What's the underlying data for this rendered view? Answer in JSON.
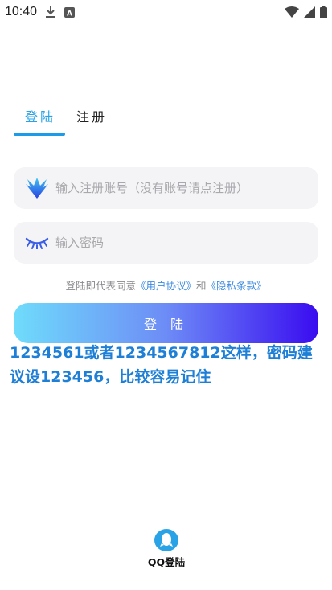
{
  "status_bar": {
    "time": "10:40",
    "icons": [
      "download-icon",
      "a-badge-icon",
      "wifi-icon",
      "signal-icon",
      "battery-icon"
    ]
  },
  "tabs": [
    {
      "label": "登陆",
      "active": true
    },
    {
      "label": "注册",
      "active": false
    }
  ],
  "account_field": {
    "placeholder": "输入注册账号（没有账号请点注册）",
    "value": "",
    "icon": "logo-icon"
  },
  "password_field": {
    "placeholder": "输入密码",
    "value": "",
    "icon": "closed-eye-icon"
  },
  "agreement": {
    "prefix": "登陆即代表同意",
    "user_agreement": "《用户协议》",
    "conjunction": "和",
    "privacy_policy": "《隐私条款》"
  },
  "login_button": {
    "label": "登 陆"
  },
  "hint_text": "1234561或者1234567812这样，密码建议设123456，比较容易记住",
  "qq_login": {
    "label": "QQ登陆",
    "icon": "qq-icon"
  },
  "colors": {
    "accent": "#2aa3e6",
    "link": "#3d8be0",
    "hint": "#1e7fd6",
    "button_gradient_start": "#6fdcfb",
    "button_gradient_end": "#3a0cf0"
  }
}
